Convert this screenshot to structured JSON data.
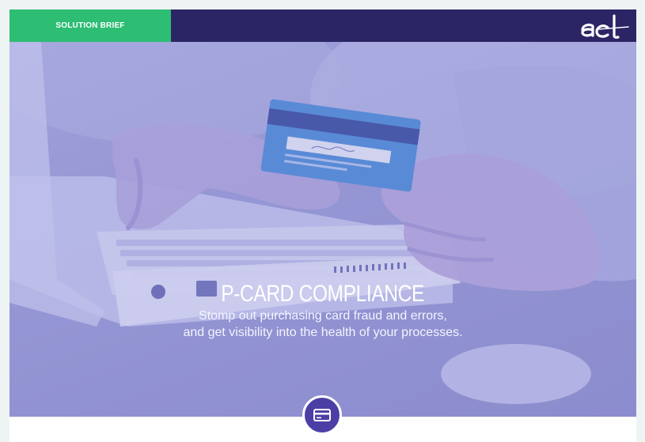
{
  "header": {
    "badge_label": "SOLUTION BRIEF",
    "logo_text": "acl",
    "colors": {
      "badge": "#2dbd73",
      "bar": "#2b2565"
    }
  },
  "hero": {
    "title": "P-CARD COMPLIANCE",
    "subtitle_line1": "Stomp out purchasing card fraud and errors,",
    "subtitle_line2": "and get visibility into the health of your processes."
  },
  "section_icon": {
    "name": "credit-card-icon",
    "color": "#4b3fa6"
  }
}
